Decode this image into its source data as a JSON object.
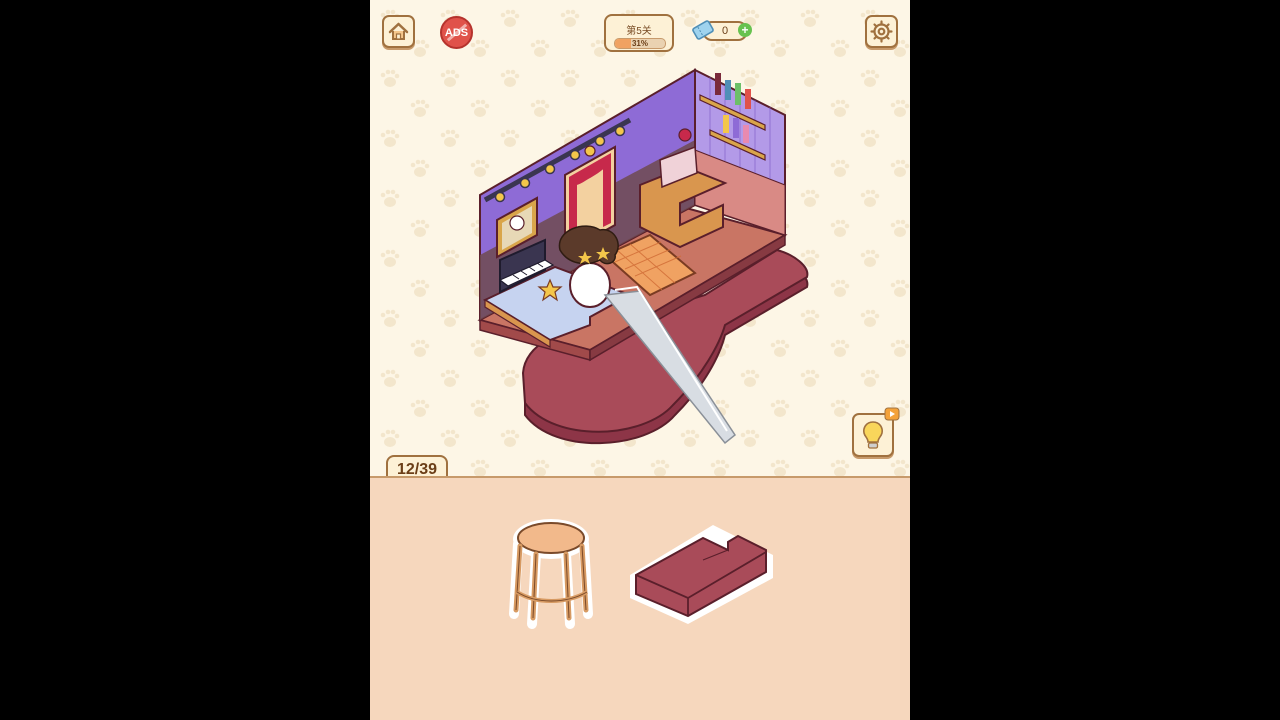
{
  "header": {
    "ads_label": "ADS",
    "level_title": "第5关",
    "progress_percent": 31,
    "progress_text": "31%",
    "ticket_count": "0",
    "ticket_plus": "+"
  },
  "icons": {
    "home": "home-icon",
    "settings": "gear-icon",
    "ticket": "ticket-icon",
    "hint": "lightbulb-icon",
    "video": "play-video-icon"
  },
  "counter": {
    "text": "12/39"
  },
  "tray": {
    "items": [
      "stool",
      "stage-step"
    ]
  },
  "colors": {
    "frame_border": "#a0713f",
    "ads_red": "#e0524a",
    "progress": "#f0a262",
    "wall_purple": "#8e6bd6",
    "floor_maroon": "#a94b59",
    "tray_bg": "#f6d7bd"
  }
}
